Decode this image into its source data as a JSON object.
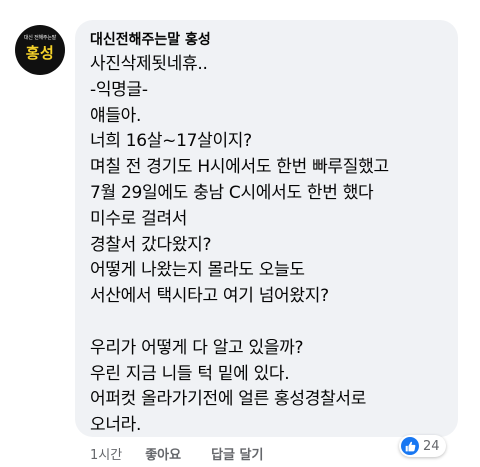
{
  "avatar": {
    "small_text": "대신 전해주는말",
    "big_text": "홍성"
  },
  "comment": {
    "author": "대신전해주는말 홍성",
    "lines": [
      "사진삭제됫네휴..",
      "-익명글-",
      "얘들아.",
      "너희 16살~17살이지?",
      "며칠 전 경기도 H시에서도 한번 빠루질했고",
      "7월 29일에도 충남 C시에서도 한번 했다",
      "미수로 걸려서",
      "경찰서 갔다왔지?",
      "어떻게 나왔는지 몰라도 오늘도",
      "서산에서 택시타고 여기 넘어왔지?",
      "",
      "우리가 어떻게 다 알고 있을까?",
      "우린 지금 니들 턱 밑에 있다.",
      "어퍼컷 올라가기전에 얼른 홍성경찰서로",
      "오너라."
    ]
  },
  "reactions": {
    "icon": "like-icon",
    "count": "24"
  },
  "actions": {
    "time": "1시간",
    "like": "좋아요",
    "reply": "답글 달기"
  },
  "colors": {
    "bubble": "#f0f2f5",
    "like_blue": "#1877f2",
    "avatar_bg": "#101010",
    "avatar_text": "#f6d32a",
    "meta_gray": "#65676b"
  }
}
